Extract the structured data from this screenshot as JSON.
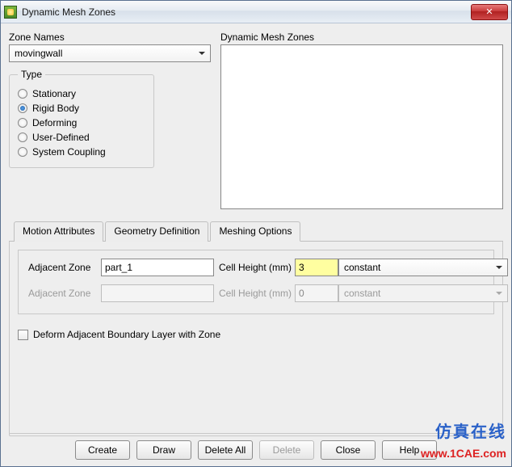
{
  "window": {
    "title": "Dynamic Mesh Zones",
    "close_glyph": "✕"
  },
  "zone_names": {
    "label": "Zone Names",
    "value": "movingwall"
  },
  "dmz": {
    "label": "Dynamic Mesh Zones"
  },
  "type": {
    "legend": "Type",
    "options": [
      {
        "label": "Stationary",
        "checked": false
      },
      {
        "label": "Rigid Body",
        "checked": true
      },
      {
        "label": "Deforming",
        "checked": false
      },
      {
        "label": "User-Defined",
        "checked": false
      },
      {
        "label": "System Coupling",
        "checked": false
      }
    ]
  },
  "tabs": [
    {
      "label": "Motion Attributes",
      "active": false
    },
    {
      "label": "Geometry Definition",
      "active": false
    },
    {
      "label": "Meshing Options",
      "active": true
    }
  ],
  "meshing": {
    "row1": {
      "adj_label": "Adjacent Zone",
      "adj_value": "part_1",
      "ch_label": "Cell Height (mm)",
      "ch_value": "3",
      "mode": "constant"
    },
    "row2": {
      "adj_label": "Adjacent Zone",
      "adj_value": "",
      "ch_label": "Cell Height (mm)",
      "ch_value": "0",
      "mode": "constant"
    },
    "deform_chk": "Deform Adjacent Boundary Layer with Zone"
  },
  "buttons": {
    "create": "Create",
    "draw": "Draw",
    "delete_all": "Delete All",
    "delete": "Delete",
    "close": "Close",
    "help": "Help"
  },
  "watermark": {
    "wm1": "仿真在线",
    "wm2": "www.1CAE.com"
  }
}
